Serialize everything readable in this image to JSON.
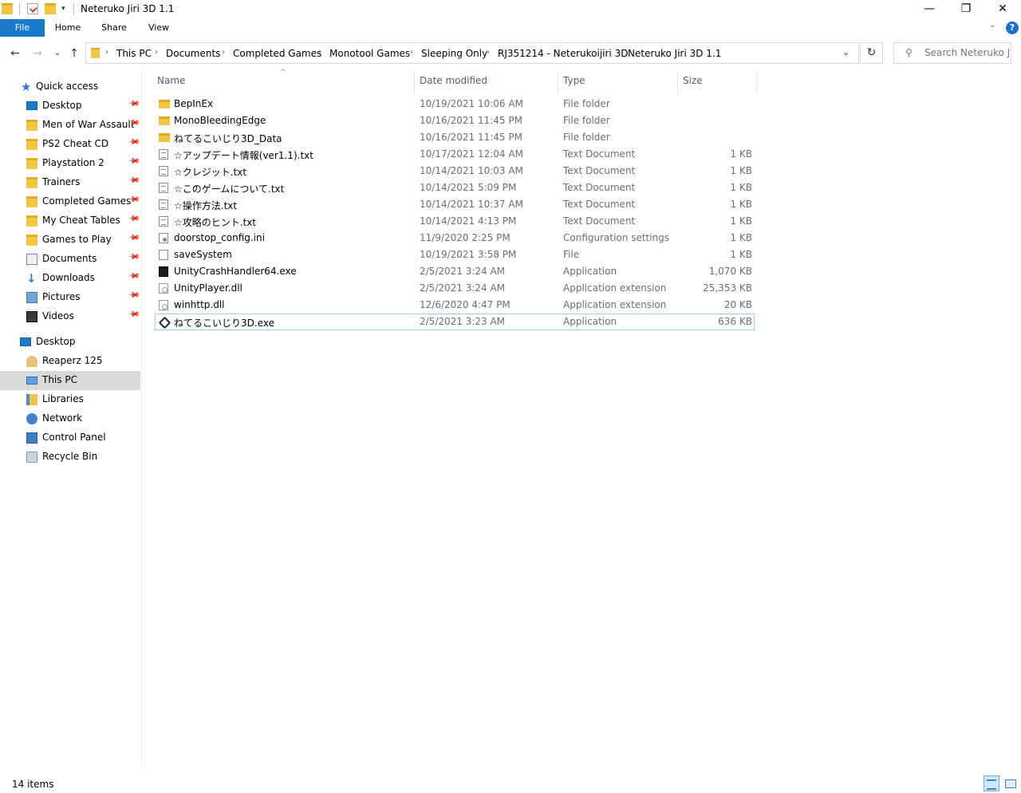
{
  "window": {
    "title": "Neteruko Jiri 3D 1.1",
    "controls": {
      "minimize": "—",
      "restore": "❐",
      "close": "✕"
    }
  },
  "quick_access_toolbar": {
    "dropdown_glyph": "▾"
  },
  "ribbon": {
    "tabs": [
      "File",
      "Home",
      "Share",
      "View"
    ],
    "expand_glyph": "⌄",
    "help_glyph": "?"
  },
  "nav": {
    "back_glyph": "←",
    "forward_glyph": "→",
    "recent_glyph": "⌄",
    "up_glyph": "↑",
    "breadcrumb": [
      "This PC",
      "Documents",
      "Completed Games",
      "Monotool Games",
      "Sleeping Only",
      "RJ351214 - Neterukoijiri 3D",
      "Neteruko Jiri 3D 1.1"
    ],
    "separator_glyph": "›",
    "address_dropdown_glyph": "⌄",
    "refresh_glyph": "↻",
    "search_placeholder": "Search Neteruko Ji...",
    "search_glyph": "⚲"
  },
  "sidebar": {
    "quick_access": "Quick access",
    "pinned": [
      {
        "label": "Desktop",
        "icon": "desktop-icon"
      },
      {
        "label": "Men of War Assault",
        "icon": "folder-icon"
      },
      {
        "label": "PS2 Cheat CD",
        "icon": "folder-icon"
      },
      {
        "label": "Playstation 2",
        "icon": "folder-icon"
      },
      {
        "label": "Trainers",
        "icon": "folder-icon"
      },
      {
        "label": "Completed Games",
        "icon": "folder-icon"
      },
      {
        "label": "My Cheat Tables",
        "icon": "folder-icon"
      },
      {
        "label": "Games to Play",
        "icon": "folder-icon"
      },
      {
        "label": "Documents",
        "icon": "documents-icon"
      },
      {
        "label": "Downloads",
        "icon": "downloads-icon"
      },
      {
        "label": "Pictures",
        "icon": "pictures-icon"
      },
      {
        "label": "Videos",
        "icon": "videos-icon"
      }
    ],
    "pin_glyph": "📌",
    "desktop_root": "Desktop",
    "desktop_children": [
      {
        "label": "Reaperz 125",
        "icon": "user-folder-icon"
      },
      {
        "label": "This PC",
        "icon": "this-pc-icon",
        "selected": true
      },
      {
        "label": "Libraries",
        "icon": "libraries-icon"
      },
      {
        "label": "Network",
        "icon": "network-icon"
      },
      {
        "label": "Control Panel",
        "icon": "control-panel-icon"
      },
      {
        "label": "Recycle Bin",
        "icon": "recycle-bin-icon"
      }
    ]
  },
  "file_list": {
    "sort_glyph": "^",
    "columns": {
      "name": "Name",
      "date": "Date modified",
      "type": "Type",
      "size": "Size"
    },
    "files": [
      {
        "name": "BepInEx",
        "date": "10/19/2021 10:06 AM",
        "type": "File folder",
        "size": "",
        "icon": "folder-icon"
      },
      {
        "name": "MonoBleedingEdge",
        "date": "10/16/2021 11:45 PM",
        "type": "File folder",
        "size": "",
        "icon": "folder-icon"
      },
      {
        "name": "ねてるこいじり3D_Data",
        "date": "10/16/2021 11:45 PM",
        "type": "File folder",
        "size": "",
        "icon": "folder-icon"
      },
      {
        "name": "☆アップデート情報(ver1.1).txt",
        "date": "10/17/2021 12:04 AM",
        "type": "Text Document",
        "size": "1 KB",
        "icon": "text-file-icon"
      },
      {
        "name": "☆クレジット.txt",
        "date": "10/14/2021 10:03 AM",
        "type": "Text Document",
        "size": "1 KB",
        "icon": "text-file-icon"
      },
      {
        "name": "☆このゲームについて.txt",
        "date": "10/14/2021 5:09 PM",
        "type": "Text Document",
        "size": "1 KB",
        "icon": "text-file-icon"
      },
      {
        "name": "☆操作方法.txt",
        "date": "10/14/2021 10:37 AM",
        "type": "Text Document",
        "size": "1 KB",
        "icon": "text-file-icon"
      },
      {
        "name": "☆攻略のヒント.txt",
        "date": "10/14/2021 4:13 PM",
        "type": "Text Document",
        "size": "1 KB",
        "icon": "text-file-icon"
      },
      {
        "name": "doorstop_config.ini",
        "date": "11/9/2020 2:25 PM",
        "type": "Configuration settings",
        "size": "1 KB",
        "icon": "config-file-icon"
      },
      {
        "name": "saveSystem",
        "date": "10/19/2021 3:58 PM",
        "type": "File",
        "size": "1 KB",
        "icon": "blank-file-icon"
      },
      {
        "name": "UnityCrashHandler64.exe",
        "date": "2/5/2021 3:24 AM",
        "type": "Application",
        "size": "1,070 KB",
        "icon": "application-icon"
      },
      {
        "name": "UnityPlayer.dll",
        "date": "2/5/2021 3:24 AM",
        "type": "Application extension",
        "size": "25,353 KB",
        "icon": "dll-file-icon"
      },
      {
        "name": "winhttp.dll",
        "date": "12/6/2020 4:47 PM",
        "type": "Application extension",
        "size": "20 KB",
        "icon": "dll-file-icon"
      },
      {
        "name": "ねてるこいじり3D.exe",
        "date": "2/5/2021 3:23 AM",
        "type": "Application",
        "size": "636 KB",
        "icon": "unity-app-icon",
        "focused": true
      }
    ]
  },
  "status": {
    "item_count": "14 items"
  },
  "colors": {
    "accent": "#1979ca",
    "selection": "#cce8ff",
    "focus_border": "#99d1ff",
    "header_text": "#4c607a",
    "secondary_text": "#6d6d6d"
  }
}
